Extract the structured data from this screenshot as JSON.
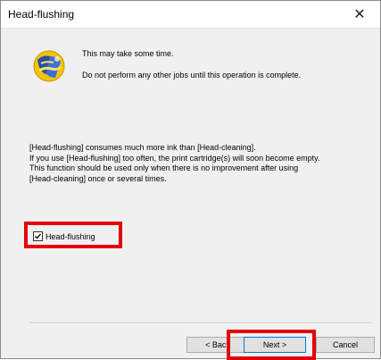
{
  "window": {
    "title": "Head-flushing",
    "close_glyph": "✕"
  },
  "message": {
    "line1": "This may take some time.",
    "line2": "Do not perform any other jobs until this operation is complete."
  },
  "warning": [
    "[Head-flushing] consumes much more ink than [Head-cleaning].",
    "If you use [Head-flushing] too often, the print cartridge(s) will soon become empty.",
    "This function should be used only when there is no improvement after using",
    "[Head-cleaning] once or several times."
  ],
  "checkbox": {
    "label": "Head-flushing",
    "checked": true
  },
  "buttons": {
    "back": "< Back",
    "next": "Next >",
    "cancel": "Cancel"
  },
  "colors": {
    "highlight": "#e30000",
    "logo_yellow": "#f5c400",
    "logo_blue": "#2a4fa8"
  },
  "icons": {
    "logo": "printer-utility-logo-icon",
    "close": "close-icon",
    "check": "check-icon"
  }
}
